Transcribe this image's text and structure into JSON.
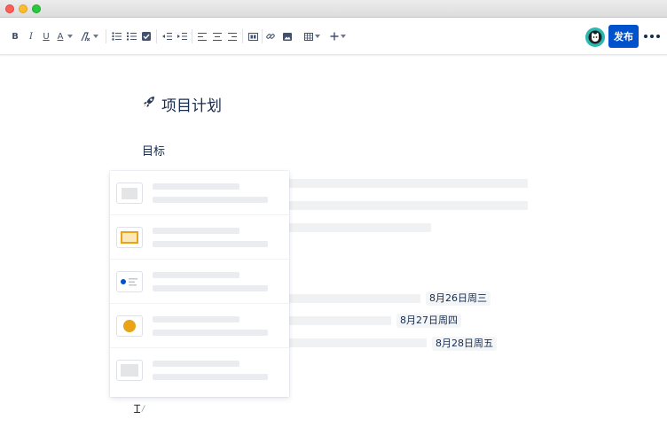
{
  "toolbar": {
    "bold": "B",
    "italic": "I",
    "underline": "U",
    "text_color": "A",
    "publish_label": "发布"
  },
  "page": {
    "title": "项目计划",
    "heading": "目标"
  },
  "dates": [
    "8月26日周三",
    "8月27日周四",
    "8月28日周五"
  ],
  "colors": {
    "primary": "#0052cc",
    "avatar": "#2ab8b0",
    "template_orange": "#e8a317",
    "template_blue": "#0052cc"
  },
  "icons": {
    "title_emoji": "rocket-icon",
    "avatar": "user-avatar-icon"
  }
}
